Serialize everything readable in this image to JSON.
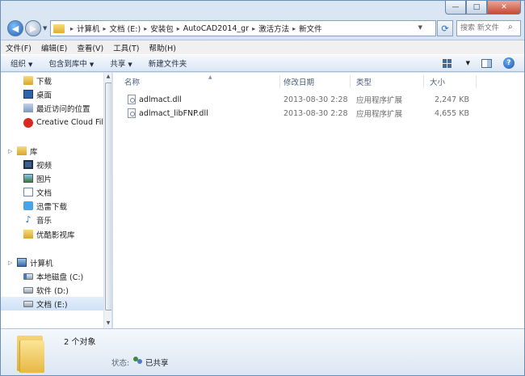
{
  "window_controls": {
    "minimize": "—",
    "maximize": "□",
    "close": "✕"
  },
  "address": {
    "crumbs": [
      "计算机",
      "文档 (E:)",
      "安装包",
      "AutoCAD2014_gr",
      "激活方法",
      "新文件"
    ],
    "separator": "▸"
  },
  "search": {
    "placeholder": "搜索 新文件"
  },
  "menu": [
    "文件(F)",
    "编辑(E)",
    "查看(V)",
    "工具(T)",
    "帮助(H)"
  ],
  "toolbar": {
    "organize": "组织",
    "include": "包含到库中",
    "share": "共享",
    "new_folder": "新建文件夹"
  },
  "nav": [
    {
      "label": "下载",
      "icon": "download-folder-icon"
    },
    {
      "label": "桌面",
      "icon": "desktop-icon"
    },
    {
      "label": "最近访问的位置",
      "icon": "recent-places-icon"
    },
    {
      "label": "Creative Cloud Files",
      "icon": "creative-cloud-icon"
    },
    {
      "label": "库",
      "icon": "library-icon"
    },
    {
      "label": "视频",
      "icon": "videos-icon"
    },
    {
      "label": "图片",
      "icon": "pictures-icon"
    },
    {
      "label": "文档",
      "icon": "documents-icon"
    },
    {
      "label": "迅雷下载",
      "icon": "xunlei-icon"
    },
    {
      "label": "音乐",
      "icon": "music-icon"
    },
    {
      "label": "优酷影视库",
      "icon": "youku-folder-icon"
    },
    {
      "label": "计算机",
      "icon": "computer-icon"
    },
    {
      "label": "本地磁盘 (C:)",
      "icon": "drive-c-icon"
    },
    {
      "label": "软件 (D:)",
      "icon": "drive-d-icon"
    },
    {
      "label": "文档 (E:)",
      "icon": "drive-e-icon"
    }
  ],
  "columns": {
    "name": "名称",
    "date": "修改日期",
    "type": "类型",
    "size": "大小"
  },
  "files": [
    {
      "name": "adlmact.dll",
      "date": "2013-08-30 2:28",
      "type": "应用程序扩展",
      "size": "2,247 KB"
    },
    {
      "name": "adlmact_libFNP.dll",
      "date": "2013-08-30 2:28",
      "type": "应用程序扩展",
      "size": "4,655 KB"
    }
  ],
  "details": {
    "count": "2 个对象",
    "status_label": "状态:",
    "status_value": "已共享"
  }
}
